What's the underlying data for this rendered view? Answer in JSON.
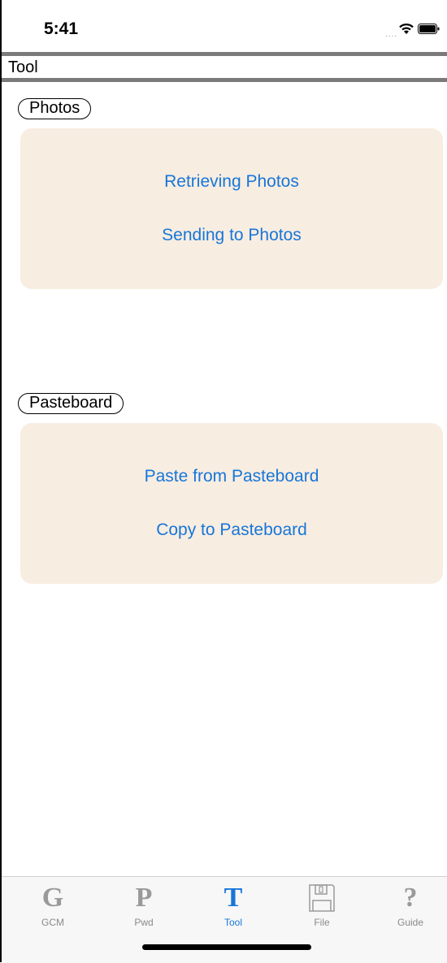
{
  "status_bar": {
    "time": "5:41",
    "signal_dots": "....",
    "icons": [
      "wifi-icon",
      "battery-icon"
    ]
  },
  "header": {
    "title": "Tool"
  },
  "sections": [
    {
      "label": "Photos",
      "buttons": [
        "Retrieving Photos",
        "Sending to Photos"
      ]
    },
    {
      "label": "Pasteboard",
      "buttons": [
        "Paste from Pasteboard",
        "Copy to Pasteboard"
      ]
    }
  ],
  "tab_bar": {
    "tabs": [
      {
        "glyph": "G",
        "label": "GCM",
        "icon": "letter-g-icon"
      },
      {
        "glyph": "P",
        "label": "Pwd",
        "icon": "letter-p-icon"
      },
      {
        "glyph": "T",
        "label": "Tool",
        "icon": "letter-t-icon"
      },
      {
        "glyph": "",
        "label": "File",
        "icon": "floppy-disk-icon"
      },
      {
        "glyph": "?",
        "label": "Guide",
        "icon": "question-mark-icon"
      }
    ],
    "active": "Tool"
  },
  "colors": {
    "accent": "#1776d8",
    "card_background": "#f8ede1",
    "rule": "#7a7a7a",
    "inactive_tab": "#9a9a9a"
  }
}
